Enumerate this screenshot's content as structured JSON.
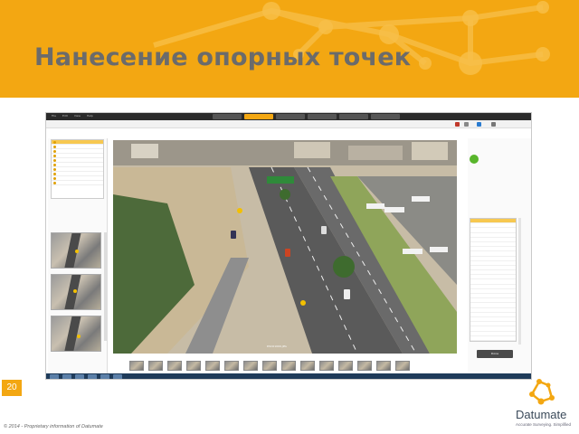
{
  "slide": {
    "title": "Нанесение опорных точек",
    "page_number": "20",
    "footer": "© 2014 - Proprietary information of Datumate",
    "accent_color": "#f3a712"
  },
  "logo": {
    "name": "Datumate",
    "tagline": "Accurate Surveying. Simplified",
    "icon": "datumate-logo-icon"
  },
  "app": {
    "menu": [
      "File",
      "Edit",
      "View",
      "Help"
    ],
    "steps": [
      "",
      "",
      "",
      "",
      "",
      ""
    ],
    "active_step": 1,
    "photo_caption": "DSC01000.JPG",
    "apply_label": "Done"
  }
}
